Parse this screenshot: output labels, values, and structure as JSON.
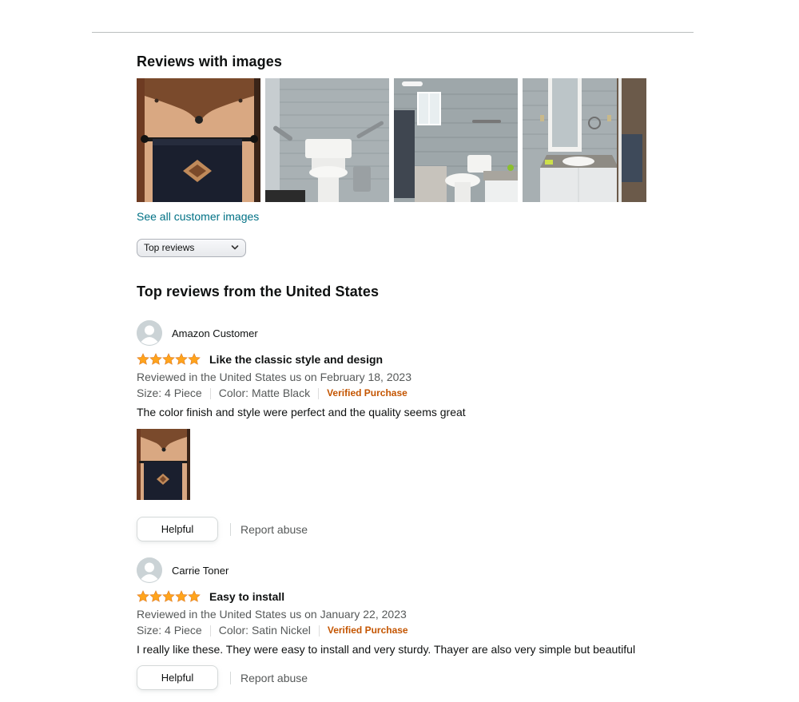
{
  "images_section": {
    "heading": "Reviews with images",
    "see_all_label": "See all customer images"
  },
  "sort": {
    "selected": "Top reviews"
  },
  "top_reviews_heading": "Top reviews from the United States",
  "reviews": [
    {
      "author": "Amazon Customer",
      "rating": 5,
      "title": "Like the classic style and design",
      "date_line": "Reviewed in the United States us on February 18, 2023",
      "size": "Size: 4 Piece",
      "color": "Color: Matte Black",
      "verified": "Verified Purchase",
      "body": "The color finish and style were perfect and the quality seems great",
      "helpful_label": "Helpful",
      "report_label": "Report abuse"
    },
    {
      "author": "Carrie Toner",
      "rating": 5,
      "title": "Easy to install",
      "date_line": "Reviewed in the United States us on January 22, 2023",
      "size": "Size: 4 Piece",
      "color": "Color: Satin Nickel",
      "verified": "Verified Purchase",
      "body": "I really like these. They were easy to install and very sturdy. Thayer are also very simple but beautiful",
      "helpful_label": "Helpful",
      "report_label": "Report abuse"
    }
  ],
  "colors": {
    "link": "#007185",
    "verified": "#c45500",
    "star": "#ffa41c",
    "muted_text": "#565959"
  },
  "icons": {
    "avatar": "default-profile-avatar-icon",
    "star": "star-filled-icon",
    "sort_chevron": "chevron-down-icon"
  }
}
